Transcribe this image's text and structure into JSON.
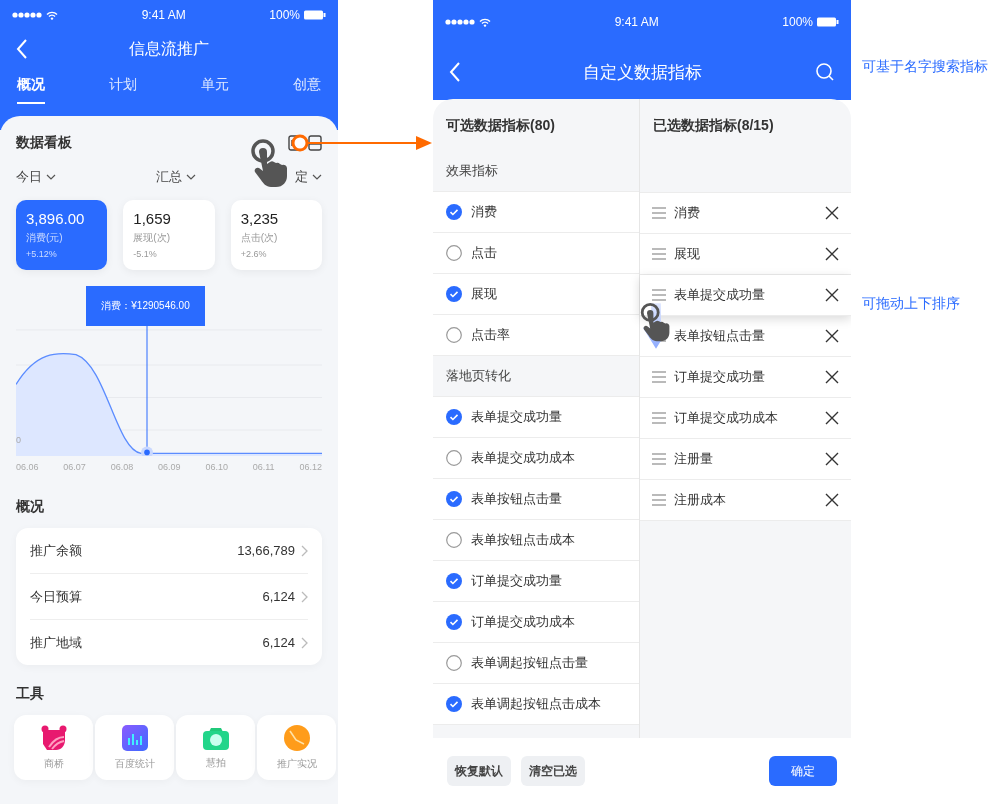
{
  "left_screen": {
    "status_bar": {
      "time": "9:41 AM",
      "battery": "100%"
    },
    "title": "信息流推广",
    "tabs": [
      {
        "label": "概况",
        "selected": true
      },
      {
        "label": "计划",
        "selected": false
      },
      {
        "label": "单元",
        "selected": false
      },
      {
        "label": "创意",
        "selected": false
      }
    ],
    "dashboard": {
      "title": "数据看板",
      "filters": [
        "今日",
        "汇总",
        "定"
      ],
      "metrics": [
        {
          "value": "3,896.00",
          "label": "消费(元)",
          "change": "+5.12%",
          "selected": true
        },
        {
          "value": "1,659",
          "label": "展现(次)",
          "change": "-5.1%",
          "selected": false
        },
        {
          "value": "3,235",
          "label": "点击(次)",
          "change": "+2.6%",
          "selected": false
        }
      ],
      "tooltip": "消费：¥1290546.00",
      "y_label": "0",
      "x_labels": [
        "06.06",
        "06.07",
        "06.08",
        "06.09",
        "06.10",
        "06.11",
        "06.12"
      ]
    },
    "overview": {
      "title": "概况",
      "rows": [
        {
          "label": "推广余额",
          "value": "13,66,789"
        },
        {
          "label": "今日预算",
          "value": "6,124"
        },
        {
          "label": "推广地域",
          "value": "6,124"
        }
      ]
    },
    "tools": {
      "title": "工具",
      "items": [
        {
          "label": "商桥",
          "kind": "bear"
        },
        {
          "label": "百度统计",
          "kind": "chart"
        },
        {
          "label": "慧拍",
          "kind": "camera"
        },
        {
          "label": "推广实况",
          "kind": "clock"
        }
      ]
    }
  },
  "right_screen": {
    "status_bar": {
      "time": "9:41 AM",
      "battery": "100%"
    },
    "title": "自定义数据指标",
    "available": {
      "title": "可选数据指标(80)",
      "groups": [
        {
          "title": "效果指标",
          "items": [
            {
              "label": "消费",
              "checked": true
            },
            {
              "label": "点击",
              "checked": false
            },
            {
              "label": "展现",
              "checked": true
            },
            {
              "label": "点击率",
              "checked": false
            }
          ]
        },
        {
          "title": "落地页转化",
          "items": [
            {
              "label": "表单提交成功量",
              "checked": true
            },
            {
              "label": "表单提交成功成本",
              "checked": false
            },
            {
              "label": "表单按钮点击量",
              "checked": true
            },
            {
              "label": "表单按钮点击成本",
              "checked": false
            },
            {
              "label": "订单提交成功量",
              "checked": true
            },
            {
              "label": "订单提交成功成本",
              "checked": true
            },
            {
              "label": "表单调起按钮点击量",
              "checked": false
            },
            {
              "label": "表单调起按钮点击成本",
              "checked": true
            }
          ]
        }
      ]
    },
    "chosen": {
      "title": "已选数据指标(8/15)",
      "items": [
        {
          "label": "消费",
          "dragging": false
        },
        {
          "label": "展现",
          "dragging": false
        },
        {
          "label": "表单提交成功量",
          "dragging": true
        },
        {
          "label": "表单按钮点击量",
          "dragging": false
        },
        {
          "label": "订单提交成功量",
          "dragging": false
        },
        {
          "label": "订单提交成功成本",
          "dragging": false
        },
        {
          "label": "注册量",
          "dragging": false
        },
        {
          "label": "注册成本",
          "dragging": false
        }
      ]
    },
    "buttons": [
      {
        "label": "恢复默认",
        "kind": "secondary"
      },
      {
        "label": "清空已选",
        "kind": "secondary"
      },
      {
        "label": "确定",
        "kind": "primary"
      }
    ]
  },
  "annotations": [
    "可基于名字搜索指标",
    "可拖动上下排序"
  ]
}
